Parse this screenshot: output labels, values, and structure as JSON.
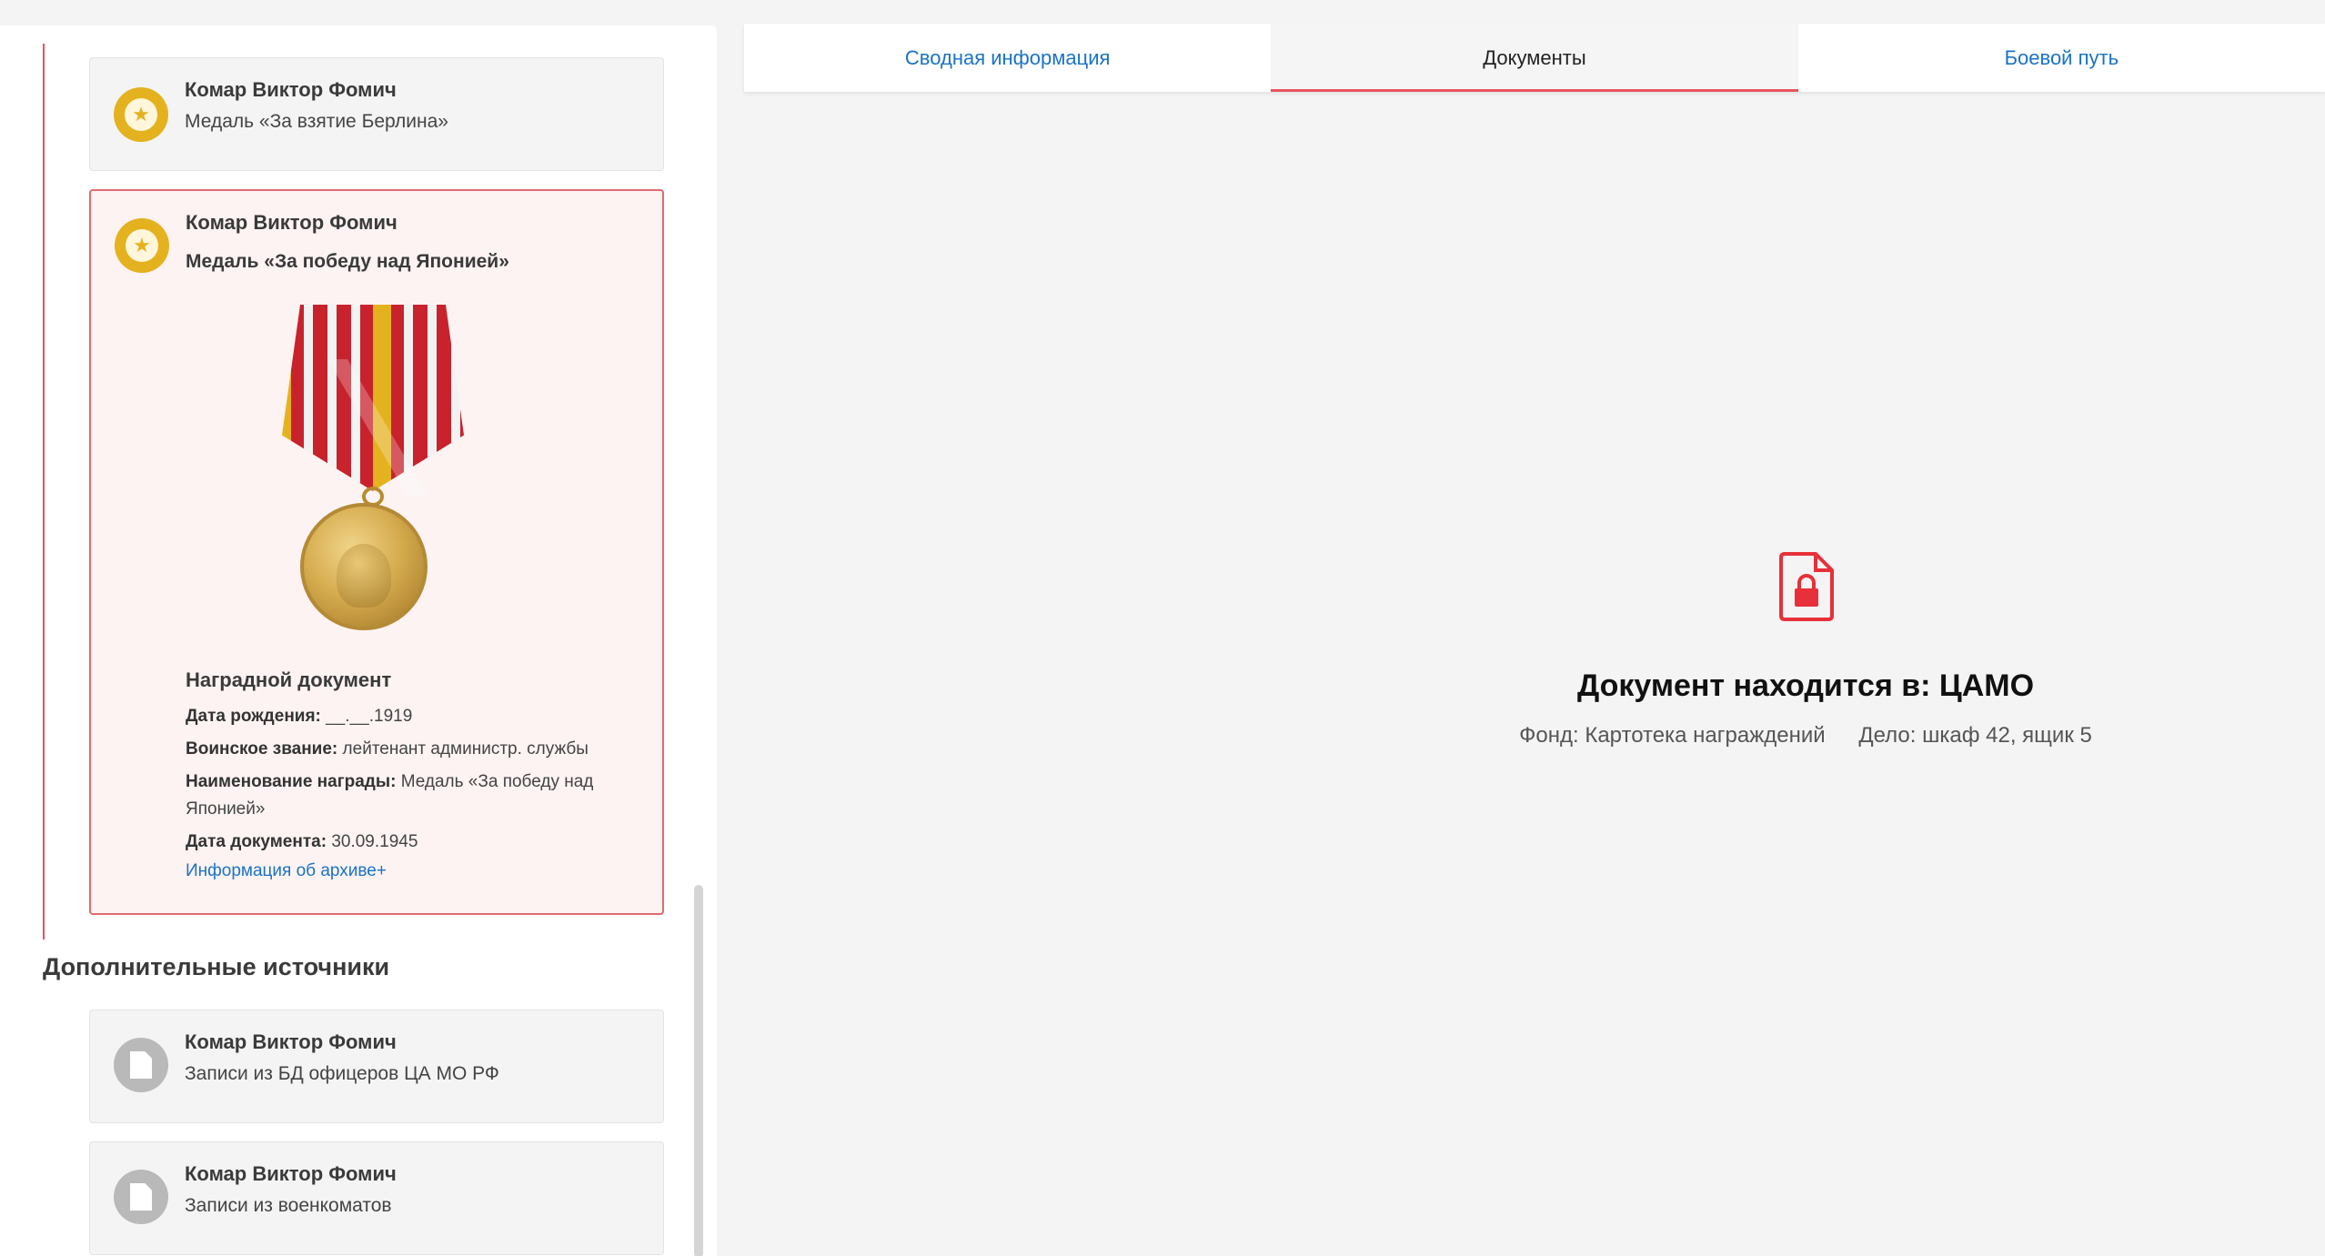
{
  "left": {
    "cards": [
      {
        "name": "Комар Виктор Фомич",
        "subtitle": "Медаль «За взятие Берлина»",
        "icon": "medal-icon"
      },
      {
        "name": "Комар Виктор Фомич",
        "subtitle": "Медаль «За победу над Японией»",
        "icon": "medal-icon",
        "award_document": {
          "title": "Наградной документ",
          "birth_label": "Дата рождения:",
          "birth_value": "__.__.1919",
          "rank_label": "Воинское звание:",
          "rank_value": "лейтенант администр. службы",
          "award_label": "Наименование награды:",
          "award_value": "Медаль «За победу над Японией»",
          "date_label": "Дата документа:",
          "date_value": "30.09.1945",
          "archive_link": "Информация об архиве+"
        }
      }
    ],
    "additional_sources": {
      "title": "Дополнительные источники",
      "items": [
        {
          "name": "Комар Виктор Фомич",
          "subtitle": "Записи из БД офицеров ЦА МО РФ",
          "icon": "document-icon"
        },
        {
          "name": "Комар Виктор Фомич",
          "subtitle": "Записи из военкоматов",
          "icon": "document-icon"
        }
      ]
    }
  },
  "tabs": [
    {
      "label": "Сводная информация",
      "active": false
    },
    {
      "label": "Документы",
      "active": true
    },
    {
      "label": "Боевой путь",
      "active": false
    }
  ],
  "document_panel": {
    "icon": "locked-document-icon",
    "heading": "Документ находится в: ЦАМО",
    "fond": "Фонд: Картотека награждений",
    "delo": "Дело: шкаф 42, ящик 5"
  },
  "colors": {
    "accent_red": "#e8545c",
    "link_blue": "#1a73c6",
    "medal_gold": "#e4b21f"
  }
}
